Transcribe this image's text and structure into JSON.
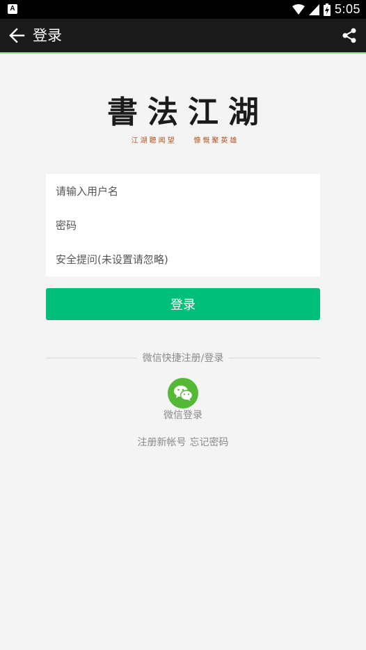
{
  "status_bar": {
    "app_icon_letter": "A",
    "time": "5:05"
  },
  "header": {
    "title": "登录",
    "back_icon": "arrow-left-icon",
    "share_icon": "share-icon"
  },
  "logo": {
    "title": "書法江湖",
    "subtitle": "江湖聽闻望    慷慨聚英雄"
  },
  "form": {
    "username_placeholder": "请输入用户名",
    "password_placeholder": "密码",
    "safety_placeholder": "安全提问(未设置请忽略)"
  },
  "login_button_label": "登录",
  "quick_login": {
    "divider_text": "微信快捷注册/登录",
    "wechat_label": "微信登录",
    "wechat_icon": "wechat-icon"
  },
  "links": {
    "register": "注册新帐号",
    "forgot_password": "忘记密码"
  },
  "colors": {
    "primary": "#00bf7a",
    "wechat": "#55b837",
    "header_bg": "#1a1a1a",
    "accent_line": "#8bd78f"
  }
}
